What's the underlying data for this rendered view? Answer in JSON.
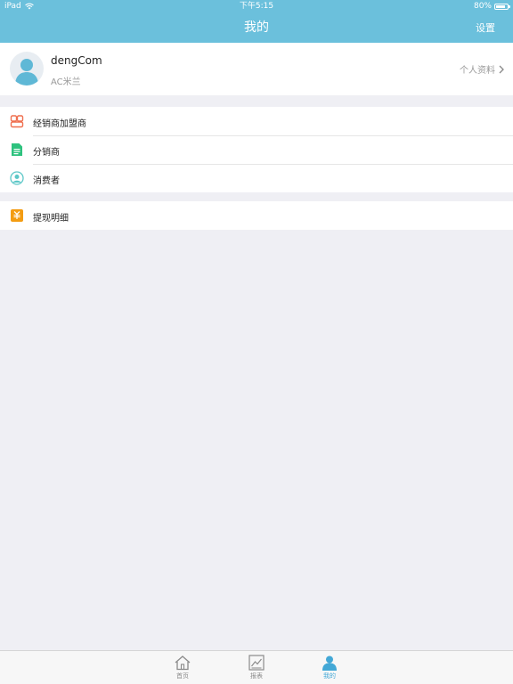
{
  "status_bar": {
    "device": "iPad",
    "time": "下午5:15",
    "battery": "80%",
    "battery_level": 0.8
  },
  "nav": {
    "title": "我的",
    "settings_label": "设置"
  },
  "profile": {
    "name": "dengCom",
    "subtitle": "AC米兰",
    "link_label": "个人资料"
  },
  "menu_group_1": [
    {
      "label": "经销商加盟商",
      "icon": "dealer-icon"
    },
    {
      "label": "分销商",
      "icon": "document-icon"
    },
    {
      "label": "消费者",
      "icon": "consumer-icon"
    }
  ],
  "menu_group_2": [
    {
      "label": "提现明细",
      "icon": "withdraw-icon"
    }
  ],
  "tabbar": {
    "tabs": [
      {
        "label": "首页",
        "icon": "home-icon"
      },
      {
        "label": "报表",
        "icon": "chart-icon"
      },
      {
        "label": "我的",
        "icon": "user-icon",
        "active": true
      }
    ]
  },
  "colors": {
    "brand": "#6bc0dc",
    "tab_active": "#43a8d6",
    "dealer_icon": "#ef6f4f",
    "document_icon": "#2ec27e",
    "consumer_icon": "#5cc7c7",
    "withdraw_icon": "#f39c12"
  }
}
